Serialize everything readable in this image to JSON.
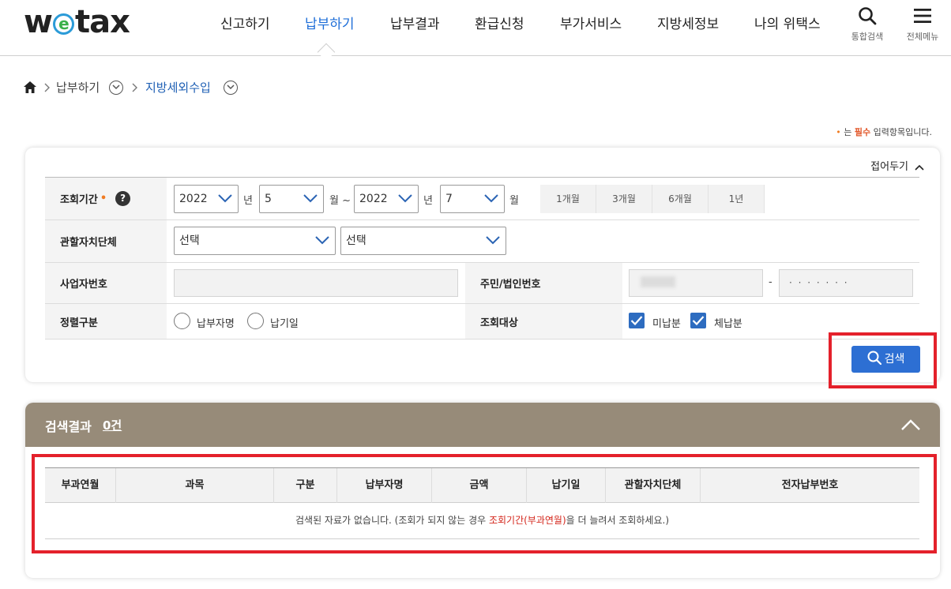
{
  "header": {
    "logo": {
      "pre": "w",
      "mid": "e",
      "post": "tax"
    },
    "nav": [
      "신고하기",
      "납부하기",
      "납부결과",
      "환급신청",
      "부가서비스",
      "지방세정보",
      "나의 위택스"
    ],
    "active_nav": "납부하기",
    "search_label": "통합검색",
    "menu_label": "전체메뉴"
  },
  "breadcrumb": {
    "level1": "납부하기",
    "level2": "지방세외수입"
  },
  "required_note": {
    "dot": "•",
    "pre": "는 ",
    "required": "필수",
    "post": " 입력항목입니다."
  },
  "search_panel": {
    "fold_label": "접어두기",
    "period": {
      "label": "조회기간",
      "required_mark": "•",
      "help": "?",
      "from_year": "2022",
      "from_month": "5",
      "to_year": "2022",
      "to_month": "7",
      "unit_year": "년",
      "unit_month": "월 ~",
      "unit_month_end": "월",
      "quick": [
        "1개월",
        "3개월",
        "6개월",
        "1년"
      ]
    },
    "jurisdiction": {
      "label": "관할자치단체",
      "select1": "선택",
      "select2": "선택"
    },
    "business_no": {
      "label": "사업자번호",
      "value": ""
    },
    "resident_no": {
      "label": "주민/법인번호",
      "front": "",
      "separator": "-",
      "back": "· · · · · · ·"
    },
    "sort": {
      "label": "정렬구분",
      "options": [
        "납부자명",
        "납기일"
      ]
    },
    "target": {
      "label": "조회대상",
      "options": [
        "미납분",
        "체납분"
      ]
    },
    "search_button": "검색"
  },
  "results": {
    "title": "검색결과",
    "count": "0건",
    "columns": [
      "부과연월",
      "과목",
      "구분",
      "납부자명",
      "금액",
      "납기일",
      "관할자치단체",
      "전자납부번호"
    ],
    "empty": {
      "pre": "검색된 자료가 없습니다. (조회가 되지 않는 경우 ",
      "highlight": "조회기간(부과연월)",
      "post": "을 더 늘려서 조회하세요.)"
    }
  },
  "colors": {
    "accent": "#1e6ed8",
    "button": "#2d6fd3",
    "result_header": "#978b79",
    "highlight_box": "#e4212b"
  }
}
